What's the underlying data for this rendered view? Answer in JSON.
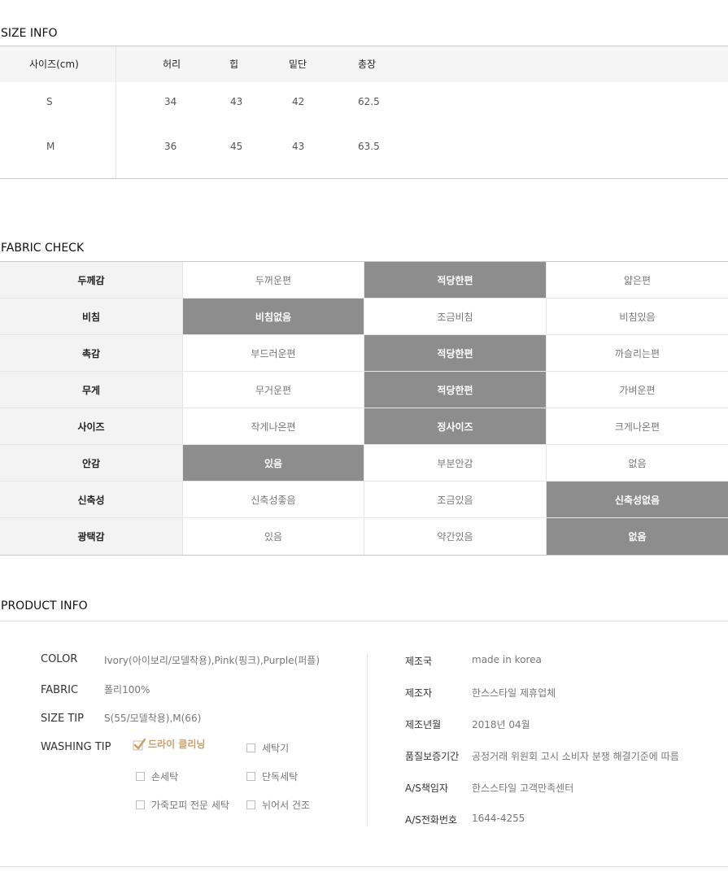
{
  "size_info": {
    "title": "SIZE INFO",
    "headers": [
      "사이즈(cm)",
      "허리",
      "힙",
      "밑단",
      "총장"
    ],
    "rows": [
      {
        "size": "S",
        "values": [
          "34",
          "43",
          "42",
          "62.5"
        ]
      },
      {
        "size": "M",
        "values": [
          "36",
          "45",
          "43",
          "63.5"
        ]
      }
    ]
  },
  "fabric_check": {
    "title": "FABRIC CHECK",
    "rows": [
      {
        "label": "두께감",
        "options": [
          "두꺼운편",
          "적당한편",
          "얇은편"
        ],
        "selected": 1
      },
      {
        "label": "비침",
        "options": [
          "비침없음",
          "조금비침",
          "비침있음"
        ],
        "selected": 0
      },
      {
        "label": "촉감",
        "options": [
          "부드러운편",
          "적당한편",
          "까슬리는편"
        ],
        "selected": 1
      },
      {
        "label": "무게",
        "options": [
          "무거운편",
          "적당한편",
          "가벼운편"
        ],
        "selected": 1
      },
      {
        "label": "사이즈",
        "options": [
          "작게나온편",
          "정사이즈",
          "크게나온편"
        ],
        "selected": 1
      },
      {
        "label": "안감",
        "options": [
          "있음",
          "부분안감",
          "없음"
        ],
        "selected": 0
      },
      {
        "label": "신축성",
        "options": [
          "신축성좋음",
          "조금있음",
          "신축성없음"
        ],
        "selected": 2
      },
      {
        "label": "광택감",
        "options": [
          "있음",
          "약간있음",
          "없음"
        ],
        "selected": 2
      }
    ]
  },
  "product_info": {
    "title": "PRODUCT INFO",
    "color_label": "COLOR",
    "color_value": "Ivory(아이보리/모델착용),Pink(핑크),Purple(퍼플)",
    "fabric_label": "FABRIC",
    "fabric_value": "폴리100%",
    "size_tip_label": "SIZE TIP",
    "size_tip_value": "S(55/모델착용),M(66)",
    "washing_tip_label": "WASHING TIP",
    "washing_tips": [
      {
        "label": "드라이 클리닝",
        "checked": true
      },
      {
        "label": "세탁기",
        "checked": false
      },
      {
        "label": "손세탁",
        "checked": false
      },
      {
        "label": "단독세탁",
        "checked": false
      },
      {
        "label": "가죽모피 전문 세탁",
        "checked": false
      },
      {
        "label": "뉘어서 건조",
        "checked": false
      }
    ],
    "details": [
      {
        "label": "제조국",
        "value": "made in korea"
      },
      {
        "label": "제조자",
        "value": "한스스타일 제휴업체"
      },
      {
        "label": "제조년월",
        "value": "2018년 04월"
      },
      {
        "label": "품질보증기간",
        "value": "공정거래 위원회 고시 소비자 분쟁 해결기준에 따름"
      },
      {
        "label": "A/S책임자",
        "value": "한스스타일 고객만족센터"
      },
      {
        "label": "A/S전화번호",
        "value": "1644-4255"
      }
    ]
  },
  "colors": {
    "selected_cell": "#8d8d8d",
    "label_cell": "#f3f3f3",
    "check_accent": "#c8a06a"
  }
}
